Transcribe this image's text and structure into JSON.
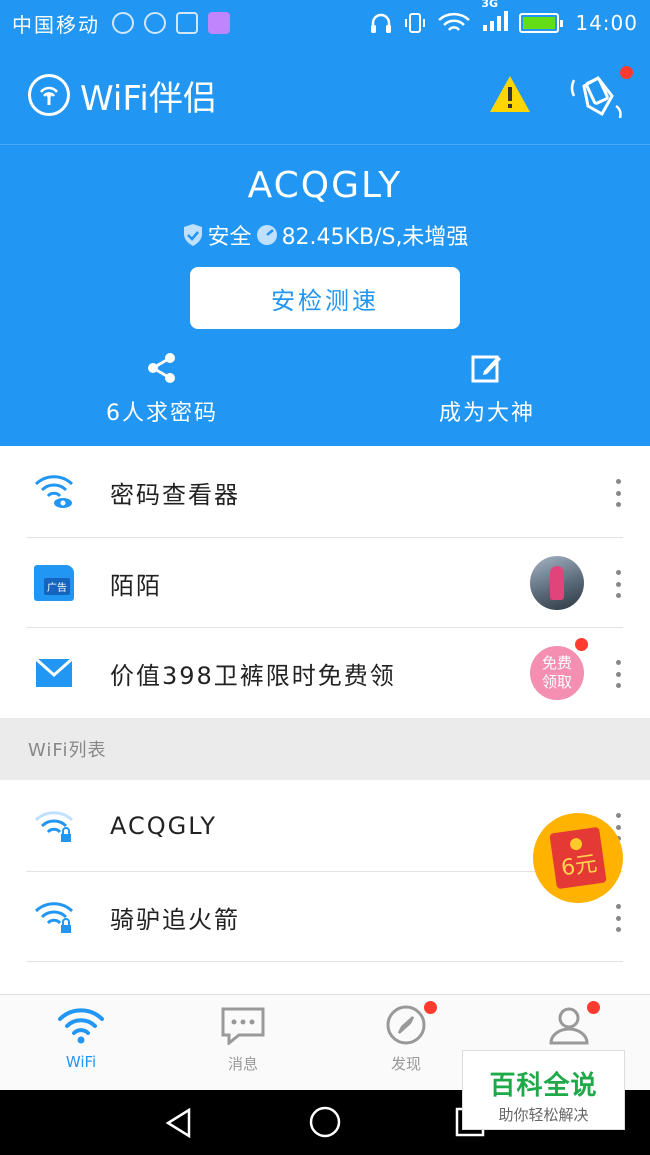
{
  "status_bar": {
    "carrier": "中国移动",
    "network": "3G",
    "time": "14:00"
  },
  "app_bar": {
    "title": "WiFi伴侣"
  },
  "hero": {
    "ssid": "ACQGLY",
    "security_label": "安全",
    "speed_status": "82.45KB/S,未增强",
    "check_button": "安检测速",
    "actions": [
      {
        "label": "6人求密码",
        "icon": "share-icon"
      },
      {
        "label": "成为大神",
        "icon": "edit-icon"
      }
    ]
  },
  "tools": [
    {
      "label": "密码查看器",
      "icon": "wifi-eye-icon"
    },
    {
      "label": "陌陌",
      "icon": "folder-ad-icon",
      "ad_tag": "广告"
    },
    {
      "label": "价值398卫裤限时免费领",
      "icon": "envelope-icon",
      "badge": "免费领取"
    }
  ],
  "wifi_section": {
    "title": "WiFi列表",
    "networks": [
      {
        "ssid": "ACQGLY",
        "locked": true
      },
      {
        "ssid": "骑驴追火箭",
        "locked": true
      }
    ]
  },
  "red_packet": {
    "amount": "6元"
  },
  "tabs": [
    {
      "label": "WiFi",
      "icon": "wifi-icon",
      "active": true
    },
    {
      "label": "消息",
      "icon": "chat-icon",
      "active": false
    },
    {
      "label": "发现",
      "icon": "compass-icon",
      "active": false
    },
    {
      "label": "",
      "icon": "user-icon",
      "active": false
    }
  ],
  "watermark": {
    "title": "百科全说",
    "subtitle": "助你轻松解决"
  },
  "colors": {
    "primary": "#2196f3",
    "alert": "#ff3b30",
    "warning": "#ffd600"
  }
}
